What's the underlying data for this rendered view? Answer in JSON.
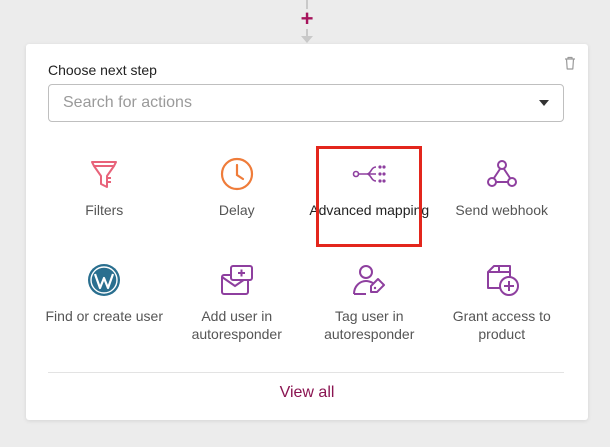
{
  "colors": {
    "brand": "#a6145c",
    "icon_purple": "#8e3f9f",
    "icon_filter": "#e8637a",
    "icon_delay": "#ef7c3a",
    "icon_wordpress": "#2a6f8f",
    "link": "#8a1451",
    "highlight": "#e3261c"
  },
  "connector": {
    "add_icon": "plus-icon"
  },
  "card": {
    "title": "Choose next step",
    "delete_icon": "trash-icon",
    "search": {
      "placeholder": "Search for actions",
      "value": ""
    },
    "actions": [
      {
        "label": "Filters",
        "icon": "filter-icon",
        "selected": false
      },
      {
        "label": "Delay",
        "icon": "clock-icon",
        "selected": false
      },
      {
        "label": "Advanced mapping",
        "icon": "mapping-icon",
        "selected": true
      },
      {
        "label": "Send webhook",
        "icon": "webhook-icon",
        "selected": false
      },
      {
        "label": "Find or create user",
        "icon": "wordpress-icon",
        "selected": false
      },
      {
        "label": "Add user in autoresponder",
        "icon": "email-add-icon",
        "selected": false
      },
      {
        "label": "Tag user in autoresponder",
        "icon": "user-tag-icon",
        "selected": false
      },
      {
        "label": "Grant access to product",
        "icon": "product-add-icon",
        "selected": false
      }
    ],
    "view_all": "View all"
  }
}
